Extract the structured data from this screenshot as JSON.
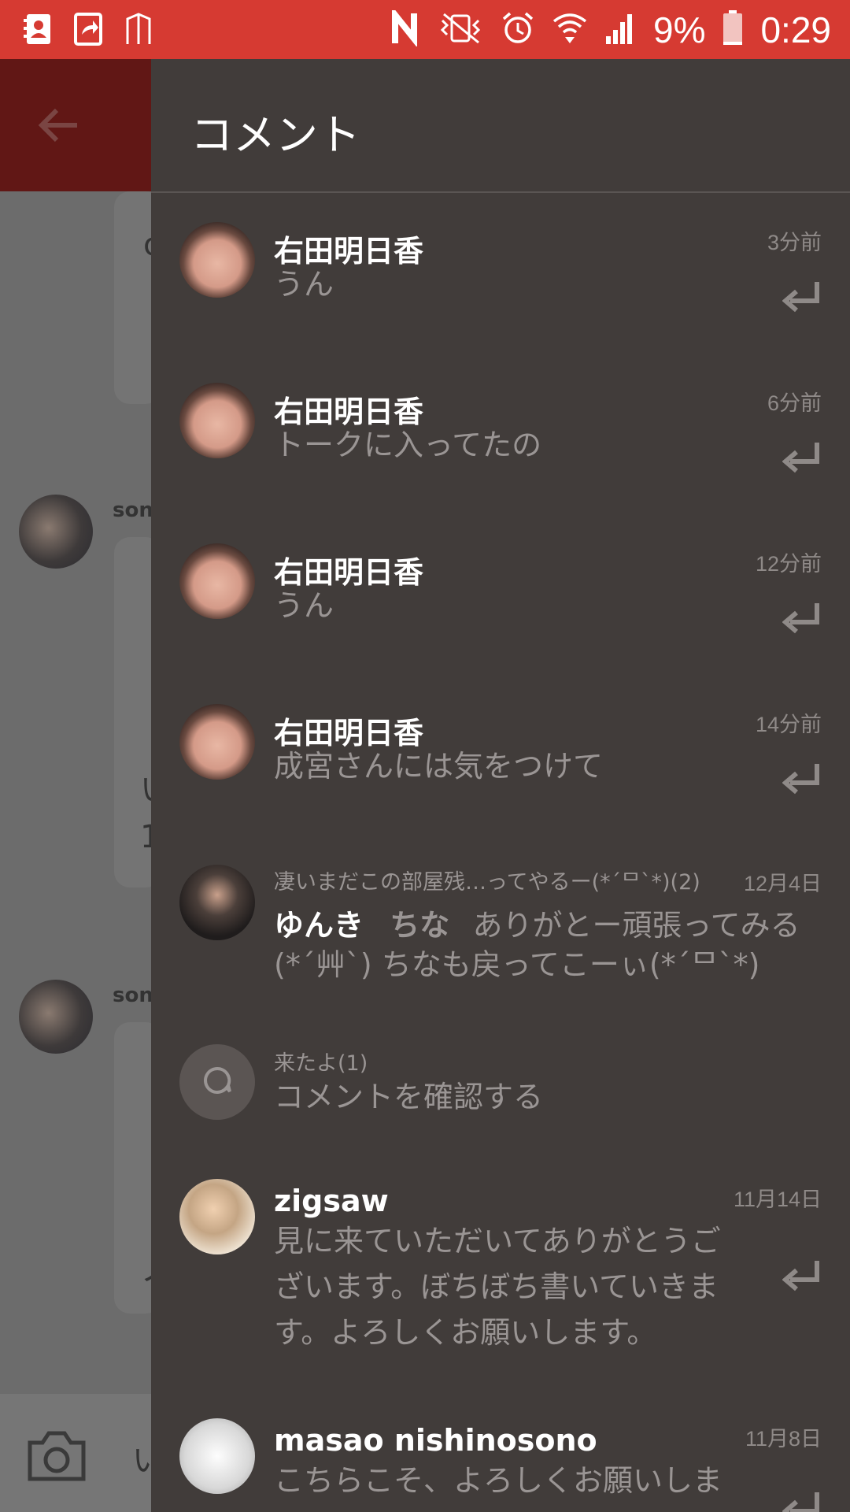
{
  "status_bar": {
    "battery": "9%",
    "time": "0:29",
    "icons_left": [
      "contacts-icon",
      "share-icon",
      "building-icon"
    ],
    "icons_right": [
      "nfc-icon",
      "vibrate-icon",
      "alarm-icon",
      "wifi-icon",
      "signal-icon",
      "battery-icon"
    ]
  },
  "background": {
    "names": [
      "son",
      "son"
    ],
    "glyphs": [
      "c",
      "い",
      "1",
      "い",
      "ノ"
    ]
  },
  "drawer": {
    "title": "コメント",
    "comments": [
      {
        "name": "右田明日香",
        "message": "うん",
        "time": "3分前"
      },
      {
        "name": "右田明日香",
        "message": "トークに入ってたの",
        "time": "6分前"
      },
      {
        "name": "右田明日香",
        "message": "うん",
        "time": "12分前"
      },
      {
        "name": "右田明日香",
        "message": "成宮さんには気をつけて",
        "time": "14分前"
      }
    ],
    "group_item": {
      "subtitle": "凄いまだこの部屋残…ってやるー(*´ᄆ`*)(2)",
      "time": "12月4日",
      "name": "ゆんき",
      "mention": "ちな",
      "line1": "ありがとー頑張ってみる",
      "line2": "(*´艸`) ちなも戻ってこーぃ(*´ᄆ`*)"
    },
    "check_item": {
      "subtitle": "来たよ(1)",
      "label": "コメントを確認する"
    },
    "zigsaw": {
      "name": "zigsaw",
      "time": "11月14日",
      "lines": [
        "見に来ていただいてありがとうご",
        "ざいます。ぼちぼち書いていきま",
        "す。よろしくお願いします。"
      ]
    },
    "masao": {
      "name": "masao nishinosono",
      "time": "11月8日",
      "line1": "こちらこそ、よろしくお願いしま"
    }
  }
}
